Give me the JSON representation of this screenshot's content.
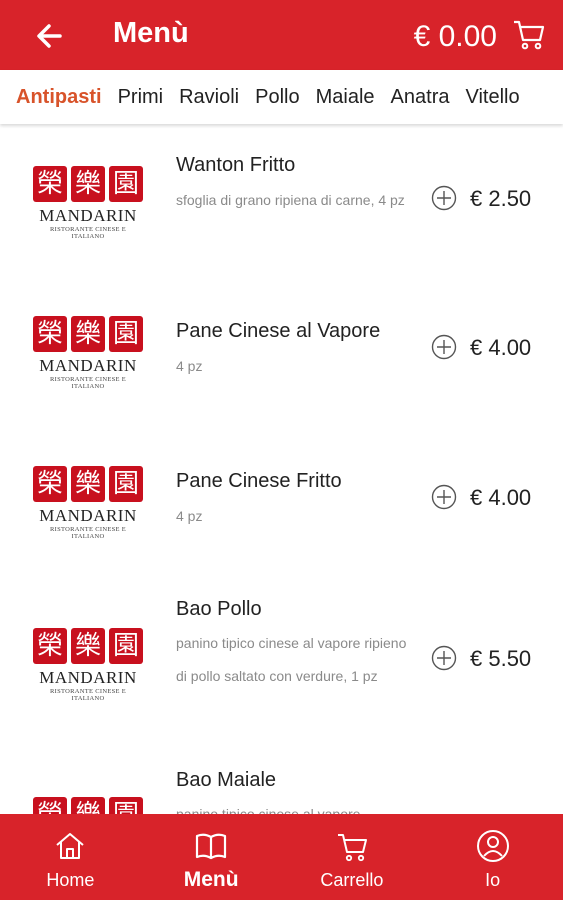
{
  "header": {
    "title": "Menù",
    "cart_total": "€ 0.00"
  },
  "tabs": [
    {
      "label": "Antipasti",
      "active": true
    },
    {
      "label": "Primi"
    },
    {
      "label": "Ravioli"
    },
    {
      "label": "Pollo"
    },
    {
      "label": "Maiale"
    },
    {
      "label": "Anatra"
    },
    {
      "label": "Vitello"
    }
  ],
  "logo": {
    "chars": [
      "榮",
      "樂",
      "園"
    ],
    "brand": "MANDARIN",
    "sub": "RISTORANTE CINESE E ITALIANO"
  },
  "items": [
    {
      "name": "Wanton Fritto",
      "desc": "sfoglia di grano ripiena di carne, 4 pz",
      "price": "€ 2.50"
    },
    {
      "name": "Pane Cinese al Vapore",
      "desc": "4 pz",
      "price": "€ 4.00"
    },
    {
      "name": "Pane Cinese Fritto",
      "desc": "4 pz",
      "price": "€ 4.00"
    },
    {
      "name": "Bao Pollo",
      "desc": "panino tipico cinese al vapore ripieno di pollo saltato con verdure, 1 pz",
      "price": "€ 5.50"
    },
    {
      "name": "Bao Maiale",
      "desc": "panino tipico cinese al vapore",
      "price": ""
    }
  ],
  "nav": [
    {
      "label": "Home",
      "icon": "home-icon"
    },
    {
      "label": "Menù",
      "icon": "book-icon",
      "active": true
    },
    {
      "label": "Carrello",
      "icon": "cart-icon"
    },
    {
      "label": "Io",
      "icon": "user-icon"
    }
  ],
  "colors": {
    "primary": "#d8232a",
    "active_tab": "#d8532a"
  }
}
